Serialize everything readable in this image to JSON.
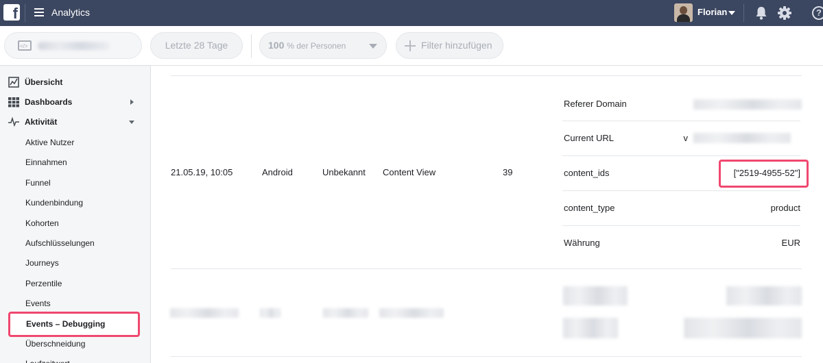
{
  "topbar": {
    "logo_letter": "f",
    "app_title": "Analytics",
    "user_name": "Florian",
    "help_symbol": "?",
    "icons": [
      "facebook-logo",
      "hamburger-icon",
      "avatar",
      "chevron-down-icon",
      "bell-icon",
      "gear-icon",
      "help-icon"
    ]
  },
  "filters": {
    "date_range": "Letzte 28 Tage",
    "people_percent": "100",
    "people_suffix": "% der Personen",
    "add_filter": "Filter hinzufügen"
  },
  "sidebar": {
    "top_items": [
      {
        "label": "Übersicht",
        "icon": "chart-icon"
      },
      {
        "label": "Dashboards",
        "icon": "grid-icon"
      },
      {
        "label": "Aktivität",
        "icon": "pulse-icon"
      }
    ],
    "sub_items": [
      "Aktive Nutzer",
      "Einnahmen",
      "Funnel",
      "Kundenbindung",
      "Kohorten",
      "Aufschlüsselungen",
      "Journeys",
      "Perzentile",
      "Events",
      "Events – Debugging",
      "Überschneidung",
      "Laufzeitwert"
    ]
  },
  "event_row": {
    "timestamp": "21.05.19, 10:05",
    "platform": "Android",
    "browser": "Unbekannt",
    "event_name": "Content View",
    "count": "39"
  },
  "event_details": [
    {
      "label": "Referer Domain",
      "value": ""
    },
    {
      "label": "Current URL",
      "value": "v"
    },
    {
      "label": "content_ids",
      "value": "[\"2519-4955-52\"]"
    },
    {
      "label": "content_type",
      "value": "product"
    },
    {
      "label": "Währung",
      "value": "EUR"
    }
  ],
  "colors": {
    "topbar": "#3b4660",
    "highlight": "#f0476f",
    "sidebar_bg": "#f5f6f7"
  }
}
